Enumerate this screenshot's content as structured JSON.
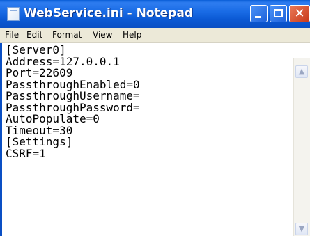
{
  "window": {
    "title": "WebService.ini - Notepad",
    "colors": {
      "titlebar": "#0a5fd8",
      "menubar": "#ece9d8",
      "close_button": "#c8391a",
      "editor_background": "#ffffff"
    }
  },
  "titlebar": {
    "app_icon": "notepad-icon",
    "minimize_icon": "minimize-icon",
    "maximize_icon": "maximize-icon",
    "close_icon": "close-icon",
    "close_glyph": "✕"
  },
  "menu": {
    "items": [
      "File",
      "Edit",
      "Format",
      "View",
      "Help"
    ]
  },
  "editor": {
    "content": "[Server0]\nAddress=127.0.0.1\nPort=22609\nPassthroughEnabled=0\nPassthroughUsername=\nPassthroughPassword=\nAutoPopulate=0\nTimeout=30\n[Settings]\nCSRF=1"
  },
  "scrollbar": {
    "up_glyph": "▲",
    "down_glyph": "▼"
  }
}
